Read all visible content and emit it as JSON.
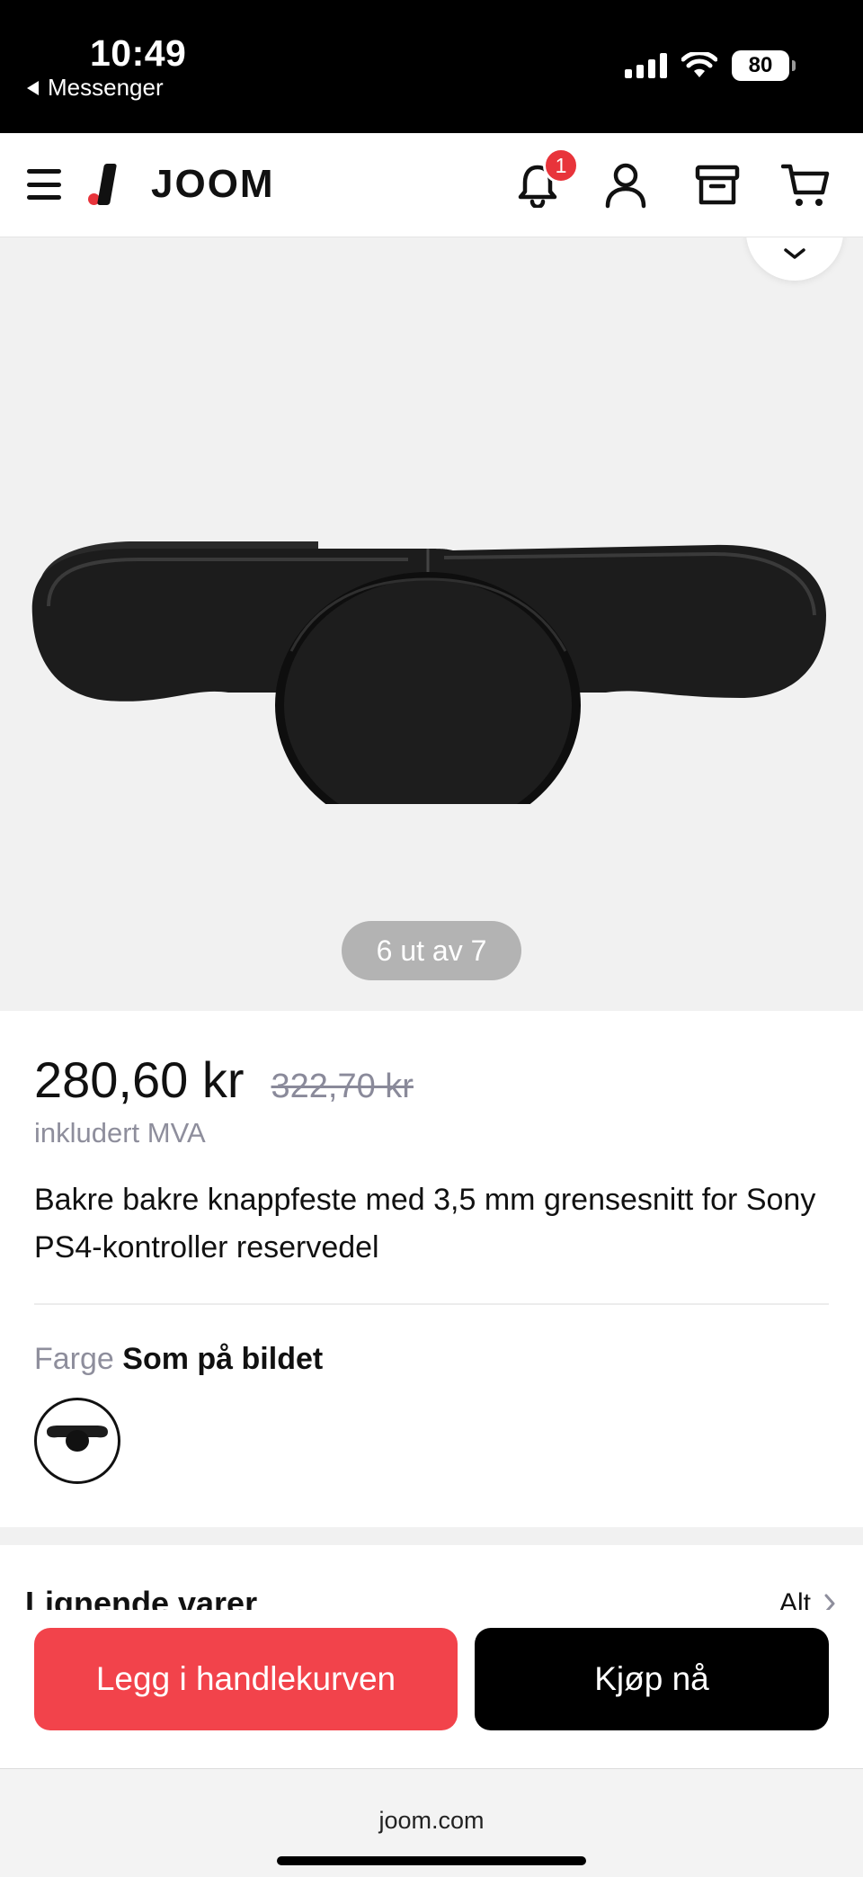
{
  "status_bar": {
    "time": "10:49",
    "back_app": "Messenger",
    "battery": "80",
    "icons": [
      "signal-icon",
      "wifi-icon",
      "battery-icon"
    ]
  },
  "header": {
    "logo_text": "JOOM",
    "notification_count": "1",
    "icons": [
      "menu-icon",
      "bell-icon",
      "user-icon",
      "orders-box-icon",
      "cart-icon"
    ]
  },
  "gallery": {
    "counter": "6 ut av 7",
    "collapse_icon": "chevron-down-icon"
  },
  "product": {
    "price": "280,60 kr",
    "old_price": "322,70 kr",
    "vat_note": "inkludert MVA",
    "title": "Bakre bakre knappfeste med 3,5 mm grensesnitt for Sony PS4-kontroller reservedel",
    "color_label": "Farge",
    "color_value": "Som på bildet"
  },
  "similar": {
    "title": "Lignende varer",
    "all_label": "Alt"
  },
  "actions": {
    "add_to_cart": "Legg i handlekurven",
    "buy_now": "Kjøp nå"
  },
  "browser": {
    "url": "joom.com"
  },
  "colors": {
    "accent_red": "#f2434b",
    "badge_red": "#e8343b",
    "muted_text": "#8e8e9c"
  }
}
